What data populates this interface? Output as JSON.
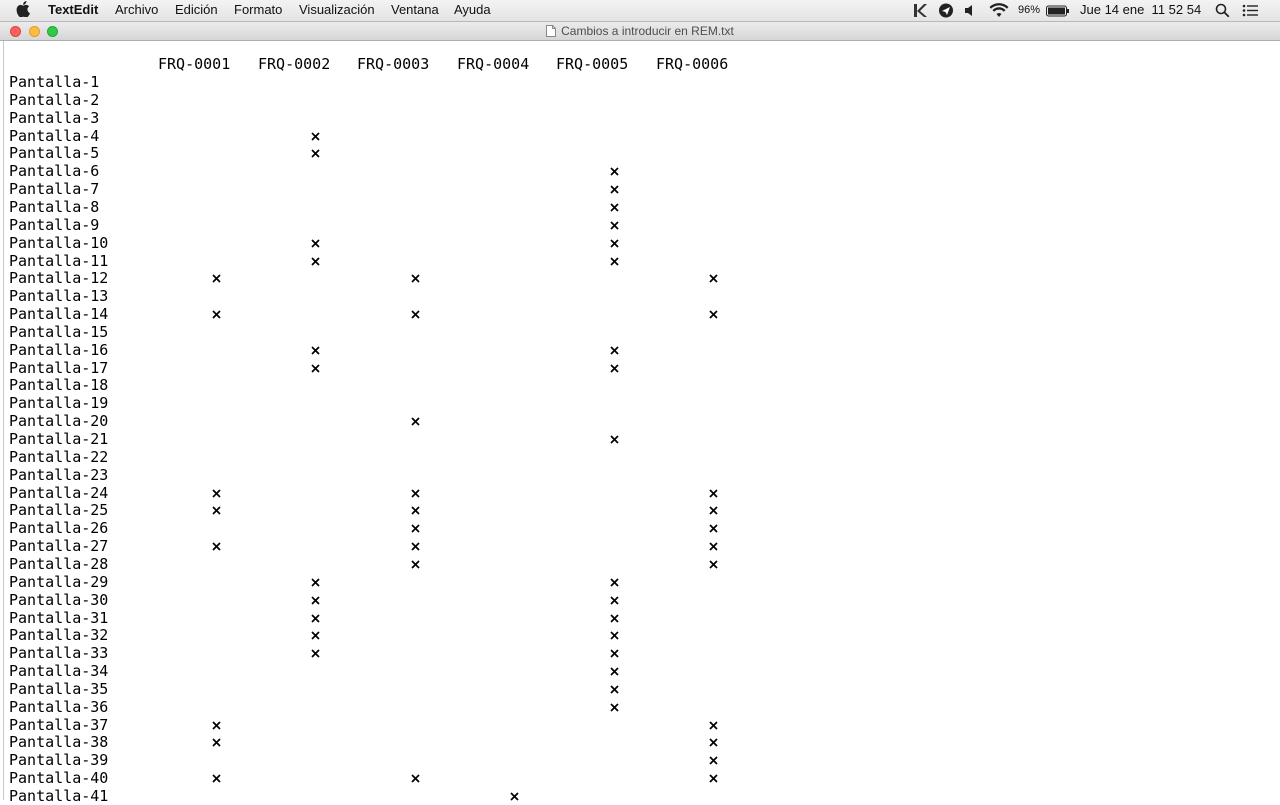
{
  "menubar": {
    "app_name": "TextEdit",
    "menus": [
      "Archivo",
      "Edición",
      "Formato",
      "Visualización",
      "Ventana",
      "Ayuda"
    ],
    "battery": "96%",
    "clock": "Jue 14 ene  11 52 54",
    "icons": [
      "apple-icon",
      "k-app-icon",
      "navigation-icon",
      "volume-icon",
      "wifi-icon",
      "battery-icon",
      "spotlight-icon",
      "notification-center-icon"
    ]
  },
  "window": {
    "title": "Cambios a introducir en REM.txt"
  },
  "document": {
    "columns": [
      "FRQ-0001",
      "FRQ-0002",
      "FRQ-0003",
      "FRQ-0004",
      "FRQ-0005",
      "FRQ-0006"
    ],
    "mark_char": "x",
    "rows": [
      {
        "label": "Pantalla-1",
        "marks": []
      },
      {
        "label": "Pantalla-2",
        "marks": []
      },
      {
        "label": "Pantalla-3",
        "marks": []
      },
      {
        "label": "Pantalla-4",
        "marks": [
          "FRQ-0002"
        ]
      },
      {
        "label": "Pantalla-5",
        "marks": [
          "FRQ-0002"
        ]
      },
      {
        "label": "Pantalla-6",
        "marks": [
          "FRQ-0005"
        ]
      },
      {
        "label": "Pantalla-7",
        "marks": [
          "FRQ-0005"
        ]
      },
      {
        "label": "Pantalla-8",
        "marks": [
          "FRQ-0005"
        ]
      },
      {
        "label": "Pantalla-9",
        "marks": [
          "FRQ-0005"
        ]
      },
      {
        "label": "Pantalla-10",
        "marks": [
          "FRQ-0002",
          "FRQ-0005"
        ]
      },
      {
        "label": "Pantalla-11",
        "marks": [
          "FRQ-0002",
          "FRQ-0005"
        ]
      },
      {
        "label": "Pantalla-12",
        "marks": [
          "FRQ-0001",
          "FRQ-0003",
          "FRQ-0006"
        ]
      },
      {
        "label": "Pantalla-13",
        "marks": []
      },
      {
        "label": "Pantalla-14",
        "marks": [
          "FRQ-0001",
          "FRQ-0003",
          "FRQ-0006"
        ]
      },
      {
        "label": "Pantalla-15",
        "marks": []
      },
      {
        "label": "Pantalla-16",
        "marks": [
          "FRQ-0002",
          "FRQ-0005"
        ]
      },
      {
        "label": "Pantalla-17",
        "marks": [
          "FRQ-0002",
          "FRQ-0005"
        ]
      },
      {
        "label": "Pantalla-18",
        "marks": []
      },
      {
        "label": "Pantalla-19",
        "marks": []
      },
      {
        "label": "Pantalla-20",
        "marks": [
          "FRQ-0003"
        ]
      },
      {
        "label": "Pantalla-21",
        "marks": [
          "FRQ-0005"
        ]
      },
      {
        "label": "Pantalla-22",
        "marks": []
      },
      {
        "label": "Pantalla-23",
        "marks": []
      },
      {
        "label": "Pantalla-24",
        "marks": [
          "FRQ-0001",
          "FRQ-0003",
          "FRQ-0006"
        ]
      },
      {
        "label": "Pantalla-25",
        "marks": [
          "FRQ-0001",
          "FRQ-0003",
          "FRQ-0006"
        ]
      },
      {
        "label": "Pantalla-26",
        "marks": [
          "FRQ-0003",
          "FRQ-0006"
        ]
      },
      {
        "label": "Pantalla-27",
        "marks": [
          "FRQ-0001",
          "FRQ-0003",
          "FRQ-0006"
        ]
      },
      {
        "label": "Pantalla-28",
        "marks": [
          "FRQ-0003",
          "FRQ-0006"
        ]
      },
      {
        "label": "Pantalla-29",
        "marks": [
          "FRQ-0002",
          "FRQ-0005"
        ]
      },
      {
        "label": "Pantalla-30",
        "marks": [
          "FRQ-0002",
          "FRQ-0005"
        ]
      },
      {
        "label": "Pantalla-31",
        "marks": [
          "FRQ-0002",
          "FRQ-0005"
        ]
      },
      {
        "label": "Pantalla-32",
        "marks": [
          "FRQ-0002",
          "FRQ-0005"
        ]
      },
      {
        "label": "Pantalla-33",
        "marks": [
          "FRQ-0002",
          "FRQ-0005"
        ]
      },
      {
        "label": "Pantalla-34",
        "marks": [
          "FRQ-0005"
        ]
      },
      {
        "label": "Pantalla-35",
        "marks": [
          "FRQ-0005"
        ]
      },
      {
        "label": "Pantalla-36",
        "marks": [
          "FRQ-0005"
        ]
      },
      {
        "label": "Pantalla-37",
        "marks": [
          "FRQ-0001",
          "FRQ-0006"
        ]
      },
      {
        "label": "Pantalla-38",
        "marks": [
          "FRQ-0001",
          "FRQ-0006"
        ]
      },
      {
        "label": "Pantalla-39",
        "marks": [
          "FRQ-0006"
        ]
      },
      {
        "label": "Pantalla-40",
        "marks": [
          "FRQ-0001",
          "FRQ-0003",
          "FRQ-0006"
        ]
      },
      {
        "label": "Pantalla-41",
        "marks": [
          "FRQ-0004"
        ]
      }
    ]
  }
}
